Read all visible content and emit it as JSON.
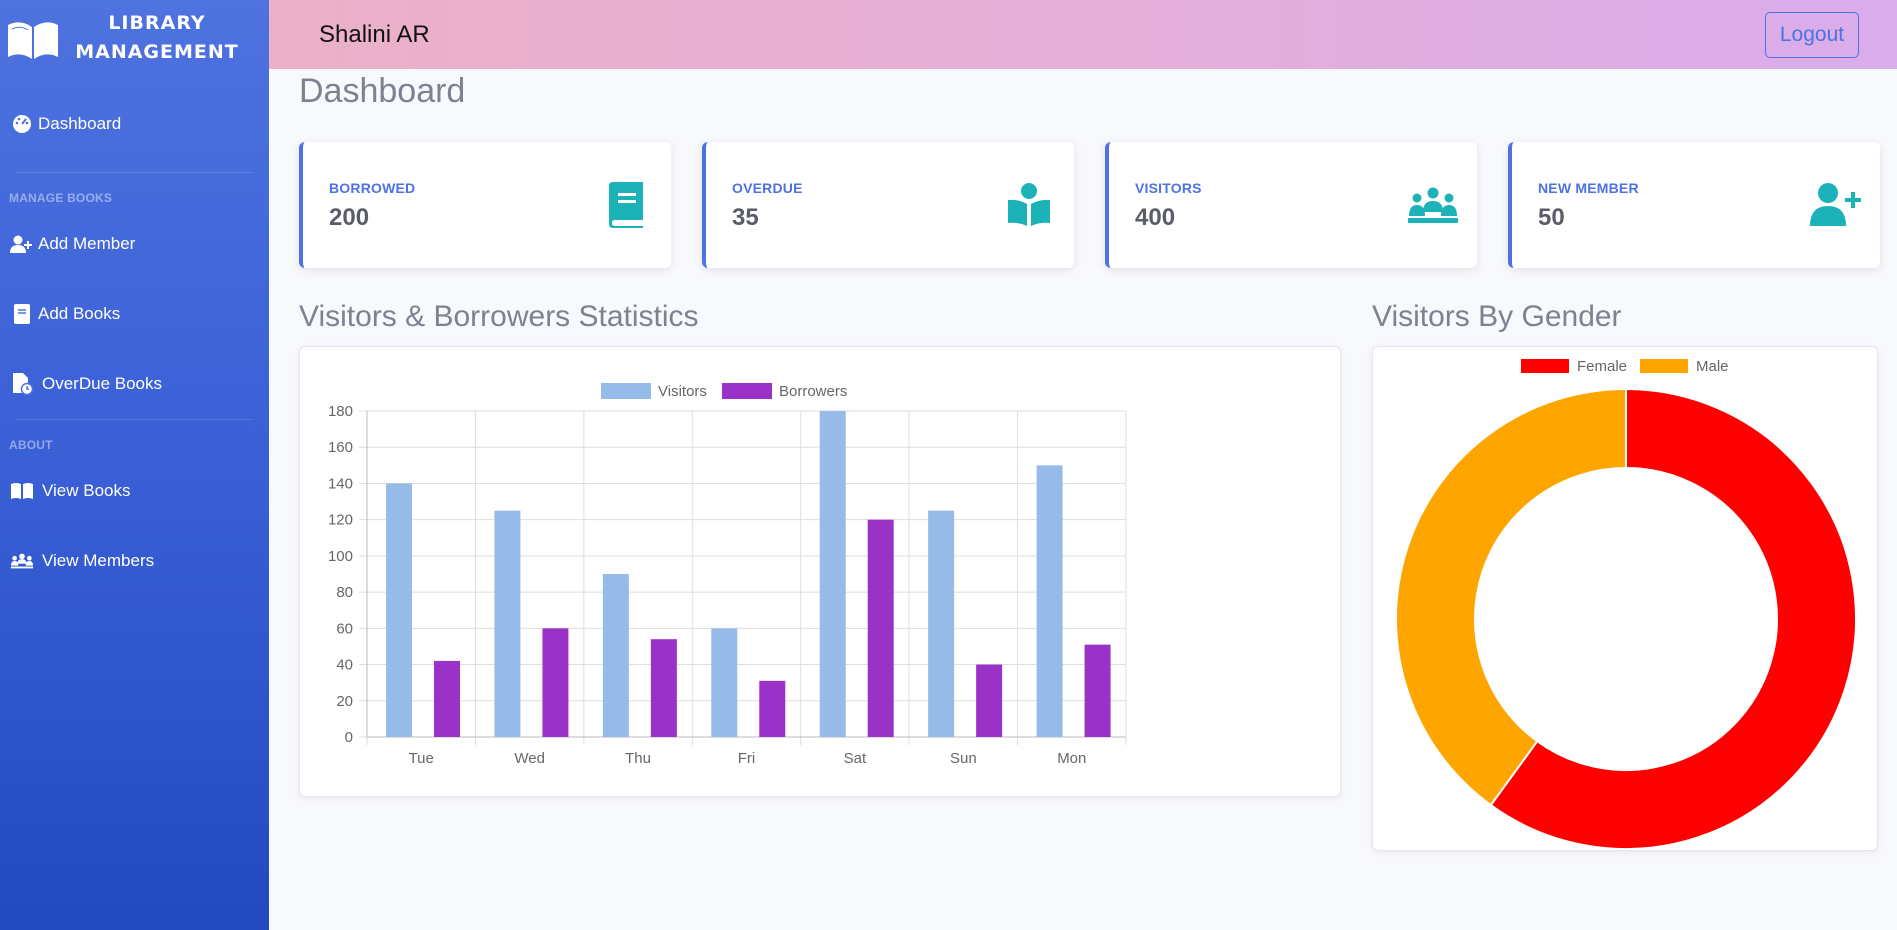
{
  "brand": {
    "line1": "LIBRARY",
    "line2": "MANAGEMENT"
  },
  "sidebar": {
    "dashboard": "Dashboard",
    "section_manage": "MANAGE BOOKS",
    "add_member": "Add Member",
    "add_books": "Add Books",
    "overdue_books": "OverDue Books",
    "section_about": "ABOUT",
    "view_books": "View Books",
    "view_members": "View Members"
  },
  "topbar": {
    "username": "Shalini AR",
    "logout": "Logout"
  },
  "page_title": "Dashboard",
  "cards": [
    {
      "label": "BORROWED",
      "value": "200",
      "icon": "book-icon"
    },
    {
      "label": "OVERDUE",
      "value": "35",
      "icon": "reader-icon"
    },
    {
      "label": "VISITORS",
      "value": "400",
      "icon": "people-icon"
    },
    {
      "label": "NEW MEMBER",
      "value": "50",
      "icon": "user-plus-icon"
    }
  ],
  "colors": {
    "accent": "#4e73df",
    "icon": "#1cb3b8",
    "visitors": "#96bbe8",
    "borrowers": "#9b32c8",
    "female": "#ff0000",
    "male": "#ffa500"
  },
  "bar_section_title": "Visitors & Borrowers Statistics",
  "pie_section_title": "Visitors By Gender",
  "chart_data": [
    {
      "type": "bar",
      "categories": [
        "Tue",
        "Wed",
        "Thu",
        "Fri",
        "Sat",
        "Sun",
        "Mon"
      ],
      "series": [
        {
          "name": "Visitors",
          "values": [
            140,
            125,
            90,
            60,
            180,
            125,
            150
          ]
        },
        {
          "name": "Borrowers",
          "values": [
            42,
            60,
            54,
            31,
            120,
            40,
            51
          ]
        }
      ],
      "yticks": [
        "0",
        "20",
        "40",
        "60",
        "80",
        "100",
        "120",
        "140",
        "160",
        "180"
      ],
      "ylim": [
        0,
        180
      ],
      "grid": true,
      "legend": "top"
    },
    {
      "type": "pie",
      "labels": [
        "Female",
        "Male"
      ],
      "values": [
        60,
        40
      ],
      "legend": "top"
    }
  ]
}
